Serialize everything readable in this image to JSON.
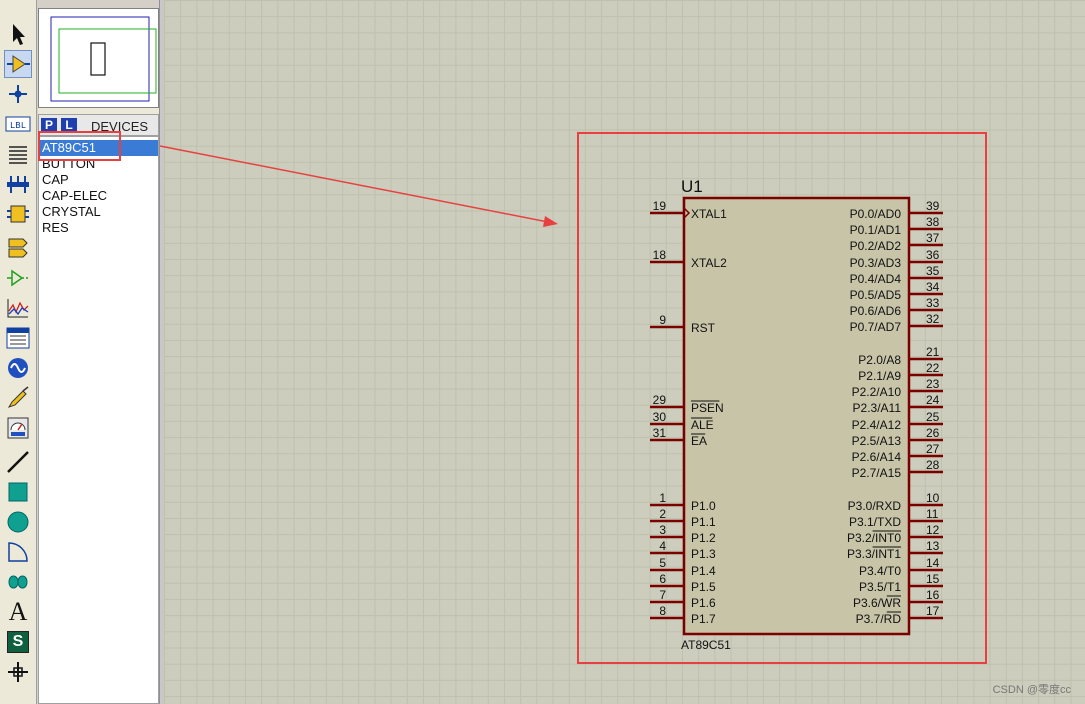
{
  "toolbar": {
    "tools": [
      {
        "name": "selection-tool",
        "icon": "arrow-cursor-icon"
      },
      {
        "name": "component-tool",
        "icon": "component-icon"
      },
      {
        "name": "junction-tool",
        "icon": "junction-dot-icon"
      },
      {
        "name": "wire-label-tool",
        "icon": "label-icon",
        "text": "LBL"
      },
      {
        "name": "text-script-tool",
        "icon": "text-lines-icon"
      },
      {
        "name": "bus-tool",
        "icon": "bus-icon"
      },
      {
        "name": "subcircuit-tool",
        "icon": "subcircuit-icon"
      },
      {
        "name": "terminal-tool",
        "icon": "terminal-icon"
      },
      {
        "name": "device-pin-tool",
        "icon": "pin-icon"
      },
      {
        "name": "graph-tool",
        "icon": "graph-icon"
      },
      {
        "name": "tape-recorder-tool",
        "icon": "tape-icon"
      },
      {
        "name": "generator-tool",
        "icon": "sine-wave-icon"
      },
      {
        "name": "voltage-probe-tool",
        "icon": "probe-icon"
      },
      {
        "name": "virtual-instrument-tool",
        "icon": "meter-icon"
      },
      {
        "name": "line-tool",
        "icon": "line-icon"
      },
      {
        "name": "box-tool",
        "icon": "box-icon"
      },
      {
        "name": "circle-tool",
        "icon": "circle-icon"
      },
      {
        "name": "arc-tool",
        "icon": "arc-icon"
      },
      {
        "name": "path-tool",
        "icon": "path-icon"
      },
      {
        "name": "text-tool",
        "icon": "text-a-icon",
        "text": "A"
      },
      {
        "name": "symbol-tool",
        "icon": "symbol-s-icon",
        "text": "S"
      },
      {
        "name": "marker-tool",
        "icon": "marker-cross-icon"
      }
    ]
  },
  "devices": {
    "p_label": "P",
    "l_label": "L",
    "title": "DEVICES",
    "items": [
      "AT89C51",
      "BUTTON",
      "CAP",
      "CAP-ELEC",
      "CRYSTAL",
      "RES"
    ],
    "selected_index": 0
  },
  "component": {
    "ref": "U1",
    "part": "AT89C51",
    "left_pins": [
      {
        "num": "19",
        "name": "XTAL1"
      },
      {
        "num": "18",
        "name": "XTAL2"
      },
      {
        "num": "9",
        "name": "RST"
      },
      {
        "num": "29",
        "name": "PSEN"
      },
      {
        "num": "30",
        "name": "ALE"
      },
      {
        "num": "31",
        "name": "EA"
      },
      {
        "num": "1",
        "name": "P1.0"
      },
      {
        "num": "2",
        "name": "P1.1"
      },
      {
        "num": "3",
        "name": "P1.2"
      },
      {
        "num": "4",
        "name": "P1.3"
      },
      {
        "num": "5",
        "name": "P1.4"
      },
      {
        "num": "6",
        "name": "P1.5"
      },
      {
        "num": "7",
        "name": "P1.6"
      },
      {
        "num": "8",
        "name": "P1.7"
      }
    ],
    "right_pins": [
      {
        "num": "39",
        "name": "P0.0/AD0"
      },
      {
        "num": "38",
        "name": "P0.1/AD1"
      },
      {
        "num": "37",
        "name": "P0.2/AD2"
      },
      {
        "num": "36",
        "name": "P0.3/AD3"
      },
      {
        "num": "35",
        "name": "P0.4/AD4"
      },
      {
        "num": "34",
        "name": "P0.5/AD5"
      },
      {
        "num": "33",
        "name": "P0.6/AD6"
      },
      {
        "num": "32",
        "name": "P0.7/AD7"
      },
      {
        "num": "21",
        "name": "P2.0/A8"
      },
      {
        "num": "22",
        "name": "P2.1/A9"
      },
      {
        "num": "23",
        "name": "P2.2/A10"
      },
      {
        "num": "24",
        "name": "P2.3/A11"
      },
      {
        "num": "25",
        "name": "P2.4/A12"
      },
      {
        "num": "26",
        "name": "P2.5/A13"
      },
      {
        "num": "27",
        "name": "P2.6/A14"
      },
      {
        "num": "28",
        "name": "P2.7/A15"
      },
      {
        "num": "10",
        "name": "P3.0/RXD"
      },
      {
        "num": "11",
        "name": "P3.1/TXD"
      },
      {
        "num": "12",
        "name": "P3.2/INT0"
      },
      {
        "num": "13",
        "name": "P3.3/INT1"
      },
      {
        "num": "14",
        "name": "P3.4/T0"
      },
      {
        "num": "15",
        "name": "P3.5/T1"
      },
      {
        "num": "16",
        "name": "P3.6/WR"
      },
      {
        "num": "17",
        "name": "P3.7/RD"
      }
    ]
  },
  "watermark": "CSDN @零度cc",
  "colors": {
    "pin": "#7a0000",
    "body_fill": "#c8c4a8",
    "highlight": "#e84040",
    "selection_blue": "#3a7bd5"
  }
}
